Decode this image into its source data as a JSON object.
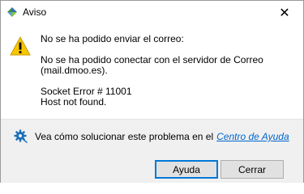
{
  "window": {
    "title": "Aviso",
    "close_glyph": "✕"
  },
  "message": {
    "line1": "No se ha podido enviar el correo:",
    "line2": "No se ha podido conectar con el servidor de Correo",
    "line3": "(mail.dmoo.es).",
    "line4": "Socket Error # 11001",
    "line5": "Host not found."
  },
  "help": {
    "text": "Vea cómo solucionar este problema en el",
    "link": "Centro de Ayuda"
  },
  "buttons": {
    "help_label": "Ayuda",
    "close_label": "Cerrar"
  },
  "colors": {
    "link": "#0066cc",
    "warning": "#f7c600",
    "gear": "#1d6fb8",
    "default_button_border": "#0078d7"
  }
}
